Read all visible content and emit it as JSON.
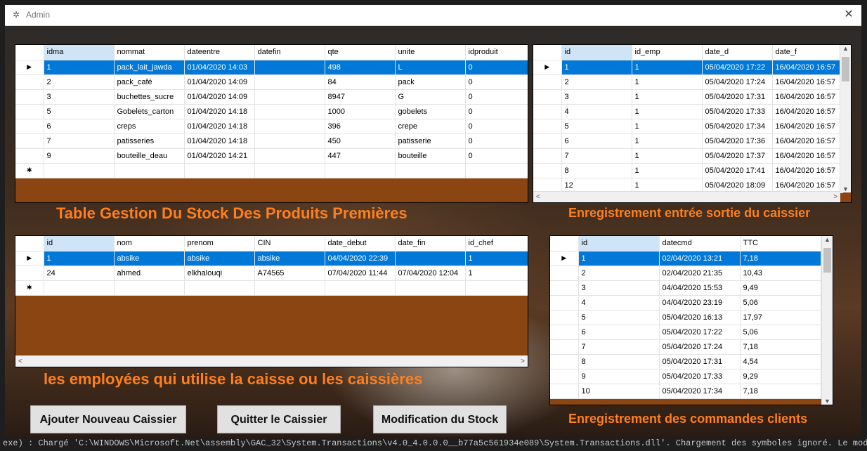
{
  "window": {
    "title": "Admin"
  },
  "console_text": "exe) : Chargé  'C:\\WINDOWS\\Microsoft.Net\\assembly\\GAC_32\\System.Transactions\\v4.0_4.0.0.0__b77a5c561934e089\\System.Transactions.dll'. Chargement des symboles ignoré. Le module e",
  "stock": {
    "caption": "Table Gestion Du Stock Des Produits Premières",
    "columns": [
      "idma",
      "nommat",
      "dateentre",
      "datefin",
      "qte",
      "unite",
      "idproduit"
    ],
    "rows": [
      [
        "1",
        "pack_lait_jawda",
        "01/04/2020 14:03",
        "",
        "498",
        "L",
        "0"
      ],
      [
        "2",
        "pack_café",
        "01/04/2020 14:09",
        "",
        "84",
        "pack",
        "0"
      ],
      [
        "3",
        "buchettes_sucre",
        "01/04/2020 14:09",
        "",
        "8947",
        "G",
        "0"
      ],
      [
        "5",
        "Gobelets_carton",
        "01/04/2020 14:18",
        "",
        "1000",
        "gobelets",
        "0"
      ],
      [
        "6",
        "creps",
        "01/04/2020 14:18",
        "",
        "396",
        "crepe",
        "0"
      ],
      [
        "7",
        "patisseries",
        "01/04/2020 14:18",
        "",
        "450",
        "patisserie",
        "0"
      ],
      [
        "9",
        "bouteille_deau",
        "01/04/2020 14:21",
        "",
        "447",
        "bouteille",
        "0"
      ]
    ]
  },
  "sessions": {
    "caption": "Enregistrement entrée sortie du caissier",
    "columns": [
      "id",
      "id_emp",
      "date_d",
      "date_f"
    ],
    "rows": [
      [
        "1",
        "1",
        "05/04/2020 17:22",
        "16/04/2020 16:57"
      ],
      [
        "2",
        "1",
        "05/04/2020 17:24",
        "16/04/2020 16:57"
      ],
      [
        "3",
        "1",
        "05/04/2020 17:31",
        "16/04/2020 16:57"
      ],
      [
        "4",
        "1",
        "05/04/2020 17:33",
        "16/04/2020 16:57"
      ],
      [
        "5",
        "1",
        "05/04/2020 17:34",
        "16/04/2020 16:57"
      ],
      [
        "6",
        "1",
        "05/04/2020 17:36",
        "16/04/2020 16:57"
      ],
      [
        "7",
        "1",
        "05/04/2020 17:37",
        "16/04/2020 16:57"
      ],
      [
        "8",
        "1",
        "05/04/2020 17:41",
        "16/04/2020 16:57"
      ],
      [
        "12",
        "1",
        "05/04/2020 18:09",
        "16/04/2020 16:57"
      ]
    ]
  },
  "employees": {
    "caption": "les employées qui utilise la caisse ou les caissières",
    "columns": [
      "id",
      "nom",
      "prenom",
      "CIN",
      "date_debut",
      "date_fin",
      "id_chef"
    ],
    "rows": [
      [
        "1",
        "absike",
        "absike",
        "absike",
        "04/04/2020 22:39",
        "",
        "1"
      ],
      [
        "24",
        "ahmed",
        "elkhalouqi",
        "A74565",
        "07/04/2020 11:44",
        "07/04/2020 12:04",
        "1"
      ]
    ]
  },
  "orders": {
    "caption": "Enregistrement des commandes clients",
    "columns": [
      "id",
      "datecmd",
      "TTC"
    ],
    "rows": [
      [
        "1",
        "02/04/2020 13:21",
        "7,18"
      ],
      [
        "2",
        "02/04/2020 21:35",
        "10,43"
      ],
      [
        "3",
        "04/04/2020 15:53",
        "9,49"
      ],
      [
        "4",
        "04/04/2020 23:19",
        "5,06"
      ],
      [
        "5",
        "05/04/2020 16:13",
        "17,97"
      ],
      [
        "6",
        "05/04/2020 17:22",
        "5,06"
      ],
      [
        "7",
        "05/04/2020 17:24",
        "7,18"
      ],
      [
        "8",
        "05/04/2020 17:31",
        "4,54"
      ],
      [
        "9",
        "05/04/2020 17:33",
        "9,29"
      ],
      [
        "10",
        "05/04/2020 17:34",
        "7,18"
      ]
    ]
  },
  "buttons": {
    "add_cashier": "Ajouter Nouveau Caissier",
    "quit_cashier": "Quitter  le  Caissier",
    "modify_stock": "Modification du Stock"
  },
  "colors": {
    "accent": "#ff7f1c",
    "selection": "#0078d7",
    "grid_bg": "#8b4513",
    "sorted_header": "#cfe4f7"
  },
  "icons": {
    "row_pointer": "triangle-right",
    "new_row": "asterisk",
    "close": "x"
  }
}
